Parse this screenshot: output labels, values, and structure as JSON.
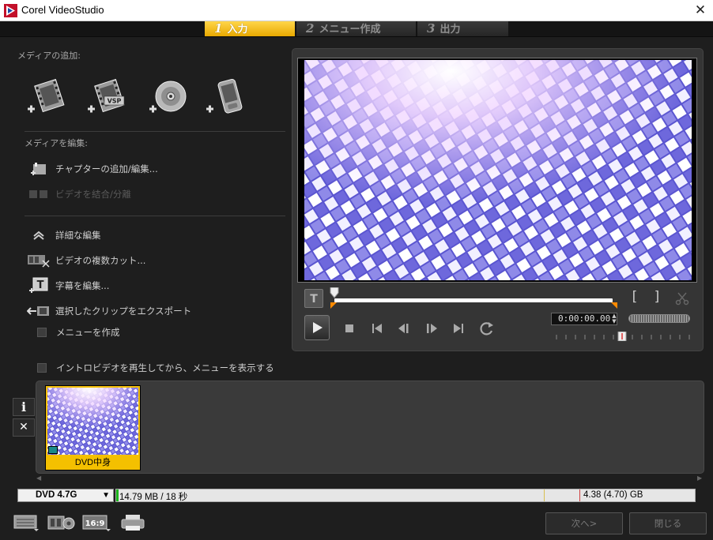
{
  "window": {
    "title": "Corel VideoStudio",
    "close_glyph": "✕"
  },
  "steps": [
    {
      "num": "1",
      "label": "入力",
      "active": true
    },
    {
      "num": "2",
      "label": "メニュー作成",
      "active": false
    },
    {
      "num": "3",
      "label": "出力",
      "active": false
    }
  ],
  "left": {
    "add_media_label": "メディアの追加:",
    "add_media_icons": [
      "add-video-icon",
      "add-vsp-project-icon",
      "import-disc-icon",
      "import-mobile-device-icon"
    ],
    "vsp_badge": "VSP",
    "edit_media_label": "メディアを編集:",
    "edit_actions": [
      {
        "label": "チャプターの追加/編集...",
        "enabled": true
      },
      {
        "label": "ビデオを結合/分離",
        "enabled": false
      }
    ],
    "advanced_label": "詳細な編集",
    "advanced_actions": [
      {
        "label": "ビデオの複数カット..."
      },
      {
        "label": "字幕を編集..."
      },
      {
        "label": "選択したクリップをエクスポート"
      }
    ],
    "create_menu_label": "メニューを作成",
    "intro_video_label": "イントロビデオを再生してから、メニューを表示する"
  },
  "preview": {
    "timecode": "0:00:00.00",
    "mark_in": "[",
    "mark_out": "]"
  },
  "storyboard": {
    "info_button": "i",
    "remove_button": "✕",
    "clips": [
      {
        "name": "DVD中身"
      }
    ]
  },
  "disc": {
    "format": "DVD 4.7G",
    "used_text": "14.79 MB / 18 秒",
    "capacity_text": "4.38 (4.70) GB",
    "used_fraction": 0.003
  },
  "footer": {
    "aspect_label": "16:9",
    "next_button": "次へ>",
    "close_button": "閉じる"
  },
  "colors": {
    "accent": "#f4c000",
    "used_bar": "#1bb51b",
    "marker": "#ff8a00"
  }
}
